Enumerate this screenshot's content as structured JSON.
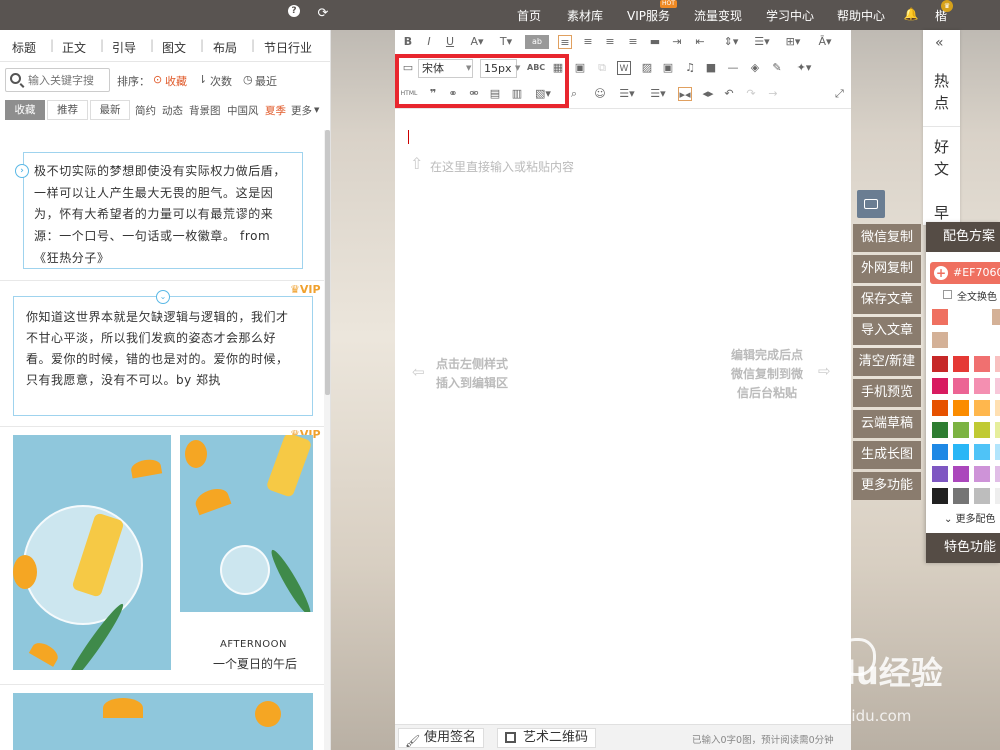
{
  "topbar": {
    "nav": [
      "首页",
      "素材库",
      "VIP服务",
      "流量变现",
      "学习中心",
      "帮助中心"
    ],
    "hot_badge": "HOT",
    "user": "楷"
  },
  "left": {
    "categories": [
      "标题",
      "正文",
      "引导",
      "图文",
      "布局",
      "节日行业"
    ],
    "search_placeholder": "输入关键字搜",
    "sort_label": "排序：",
    "sort_options": [
      "收藏",
      "次数",
      "最近"
    ],
    "filter_tabs": [
      "收藏",
      "推荐",
      "最新"
    ],
    "styles": [
      "简约",
      "动态",
      "背景图",
      "中国风",
      "夏季",
      "更多"
    ],
    "quote1": "极不切实际的梦想即使没有实际权力做后盾，一样可以让人产生最大无畏的胆气。这是因为，怀有大希望者的力量可以有最荒谬的来源：一个口号、一句话或一枚徽章。 from 《狂热分子》",
    "vip_label": "VIP",
    "quote2": "你知道这世界本就是欠缺逻辑与逻辑的，我们才不甘心平淡，所以我们发疯的姿态才会那么好看。爱你的时候，错的也是对的。爱你的时候，只有我愿意，没有不可以。by 郑执",
    "caption_en": "AFTERNOON",
    "caption_cn": "一个夏日的午后"
  },
  "editor": {
    "font": "宋体",
    "font_size": "15px",
    "placeholder": "在这里直接输入或粘贴内容",
    "hint_left": [
      "点击左侧样式",
      "插入到编辑区"
    ],
    "hint_right": [
      "编辑完成后点",
      "微信复制到微",
      "信后台粘贴"
    ],
    "html_label": "HTML"
  },
  "bottom": {
    "sign": "使用签名",
    "qr": "艺术二维码",
    "count": "已输入0字0图，预计阅读需0分钟"
  },
  "actions": [
    "微信复制",
    "外网复制",
    "保存文章",
    "导入文章",
    "清空/新建",
    "手机预览",
    "云端草稿",
    "生成长图",
    "更多功能"
  ],
  "right_tabs": [
    [
      "热",
      "点"
    ],
    [
      "好",
      "文"
    ],
    [
      "早"
    ]
  ],
  "colors": {
    "title": "配色方案",
    "current": "#EF7060",
    "swap_label": "全文换色",
    "more": "更多配色",
    "special": "特色功能",
    "history": [
      "#ef7060",
      "#d4b197",
      "#d4b197"
    ],
    "grid": [
      [
        "#c62828",
        "#e53935",
        "#f07070",
        "#f9c0c0"
      ],
      [
        "#d81b60",
        "#ec6494",
        "#f48fb1",
        "#f8c8da"
      ],
      [
        "#e65100",
        "#fb8c00",
        "#ffb74d",
        "#ffe0b2"
      ],
      [
        "#2e7d32",
        "#7cb342",
        "#c0ca33",
        "#e6ee9c"
      ],
      [
        "#1e88e5",
        "#29b6f6",
        "#4fc3f7",
        "#b3e5fc"
      ],
      [
        "#7e57c2",
        "#ab47bc",
        "#ce93d8",
        "#e1bee7"
      ],
      [
        "#212121",
        "#757575",
        "#bdbdbd",
        "#eeeeee"
      ]
    ]
  },
  "watermark": {
    "logo": "Bai  du经验",
    "url": "jingyan.baidu.com"
  }
}
